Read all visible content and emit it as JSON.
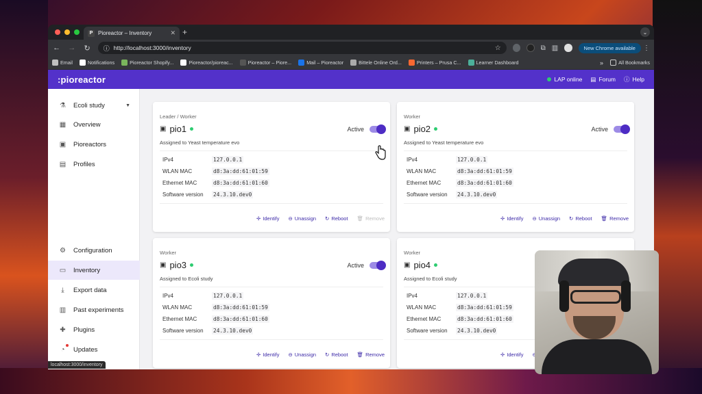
{
  "browser": {
    "tab_title": "Pioreactor – Inventory",
    "tab_favicon": "P",
    "url": "http://localhost:3000/inventory",
    "new_chrome": "New Chrome available",
    "bookmarks": [
      {
        "label": "Email",
        "color": "#c0c0c0"
      },
      {
        "label": "Notifications",
        "color": "#ffffff"
      },
      {
        "label": "Pioreactor Shopify...",
        "color": "#7ab55c"
      },
      {
        "label": "Pioreactor/pioreac...",
        "color": "#ffffff"
      },
      {
        "label": "Pioreactor – Piore...",
        "color": "#555555"
      },
      {
        "label": "Mail – Pioreactor",
        "color": "#1a73e8"
      },
      {
        "label": "Bittele Online Ord...",
        "color": "#aaaaaa"
      },
      {
        "label": "Printers – Prusa C...",
        "color": "#fa6831"
      },
      {
        "label": "Learner Dashboard",
        "color": "#4caf9a"
      }
    ],
    "all_bookmarks": "All Bookmarks",
    "status_url": "localhost:3000/inventory"
  },
  "appbar": {
    "logo": ":pioreactor",
    "lap_status": "LAP online",
    "forum": "Forum",
    "help": "Help"
  },
  "sidebar": {
    "experiment": "Ecoli study",
    "items": [
      {
        "label": "Overview",
        "icon": "grid-icon"
      },
      {
        "label": "Pioreactors",
        "icon": "chip-icon"
      },
      {
        "label": "Profiles",
        "icon": "document-icon"
      },
      {
        "label": "Configuration",
        "icon": "gear-icon"
      },
      {
        "label": "Inventory",
        "icon": "inventory-icon"
      },
      {
        "label": "Export data",
        "icon": "download-icon"
      },
      {
        "label": "Past experiments",
        "icon": "table-icon"
      },
      {
        "label": "Plugins",
        "icon": "plugin-icon"
      },
      {
        "label": "Updates",
        "icon": "update-icon"
      }
    ]
  },
  "spec_labels": {
    "ipv4": "IPv4",
    "wlan": "WLAN MAC",
    "eth": "Ethernet MAC",
    "sw": "Software version"
  },
  "action_labels": {
    "identify": "Identify",
    "unassign": "Unassign",
    "reboot": "Reboot",
    "remove": "Remove"
  },
  "cards": [
    {
      "role": "Leader / Worker",
      "name": "pio1",
      "active_label": "Active",
      "assigned": "Assigned to Yeast temperature evo",
      "ipv4": "127.0.0.1",
      "wlan": "d8:3a:dd:61:01:59",
      "eth": "d8:3a:dd:61:01:60",
      "sw": "24.3.10.dev0"
    },
    {
      "role": "Worker",
      "name": "pio2",
      "active_label": "Active",
      "assigned": "Assigned to Yeast temperature evo",
      "ipv4": "127.0.0.1",
      "wlan": "d8:3a:dd:61:01:59",
      "eth": "d8:3a:dd:61:01:60",
      "sw": "24.3.10.dev0"
    },
    {
      "role": "Worker",
      "name": "pio3",
      "active_label": "Active",
      "assigned": "Assigned to Ecoli study",
      "ipv4": "127.0.0.1",
      "wlan": "d8:3a:dd:61:01:59",
      "eth": "d8:3a:dd:61:01:60",
      "sw": "24.3.10.dev0"
    },
    {
      "role": "Worker",
      "name": "pio4",
      "active_label": "",
      "assigned": "Assigned to Ecoli study",
      "ipv4": "127.0.0.1",
      "wlan": "d8:3a:dd:61:01:59",
      "eth": "d8:3a:dd:61:01:60",
      "sw": "24.3.10.dev0"
    }
  ],
  "colors": {
    "accent": "#5331ca",
    "online": "#2ecc71"
  }
}
